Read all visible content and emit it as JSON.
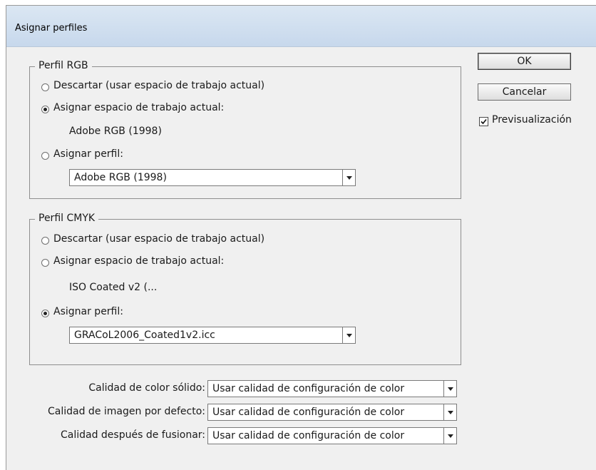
{
  "window": {
    "title": "Asignar perfiles"
  },
  "rgb": {
    "legend": "Perfil RGB",
    "options": [
      "Descartar (usar espacio de trabajo actual)",
      "Asignar espacio de trabajo actual:",
      "Asignar perfil:"
    ],
    "selected_index": 1,
    "working_space": "Adobe RGB (1998)",
    "profile_select": "Adobe RGB (1998)"
  },
  "cmyk": {
    "legend": "Perfil CMYK",
    "options": [
      "Descartar (usar espacio de trabajo actual)",
      "Asignar espacio de trabajo actual:",
      "Asignar perfil:"
    ],
    "selected_index": 2,
    "working_space": "ISO Coated v2 (...",
    "profile_select": "GRACoL2006_Coated1v2.icc"
  },
  "quality": [
    {
      "label": "Calidad de color sólido:",
      "value": "Usar calidad de configuración de color"
    },
    {
      "label": "Calidad de imagen por defecto:",
      "value": "Usar calidad de configuración de color"
    },
    {
      "label": "Calidad después de fusionar:",
      "value": "Usar calidad de configuración de color"
    }
  ],
  "buttons": {
    "ok": "OK",
    "cancel": "Cancelar"
  },
  "preview": {
    "label": "Previsualización",
    "checked": true
  }
}
